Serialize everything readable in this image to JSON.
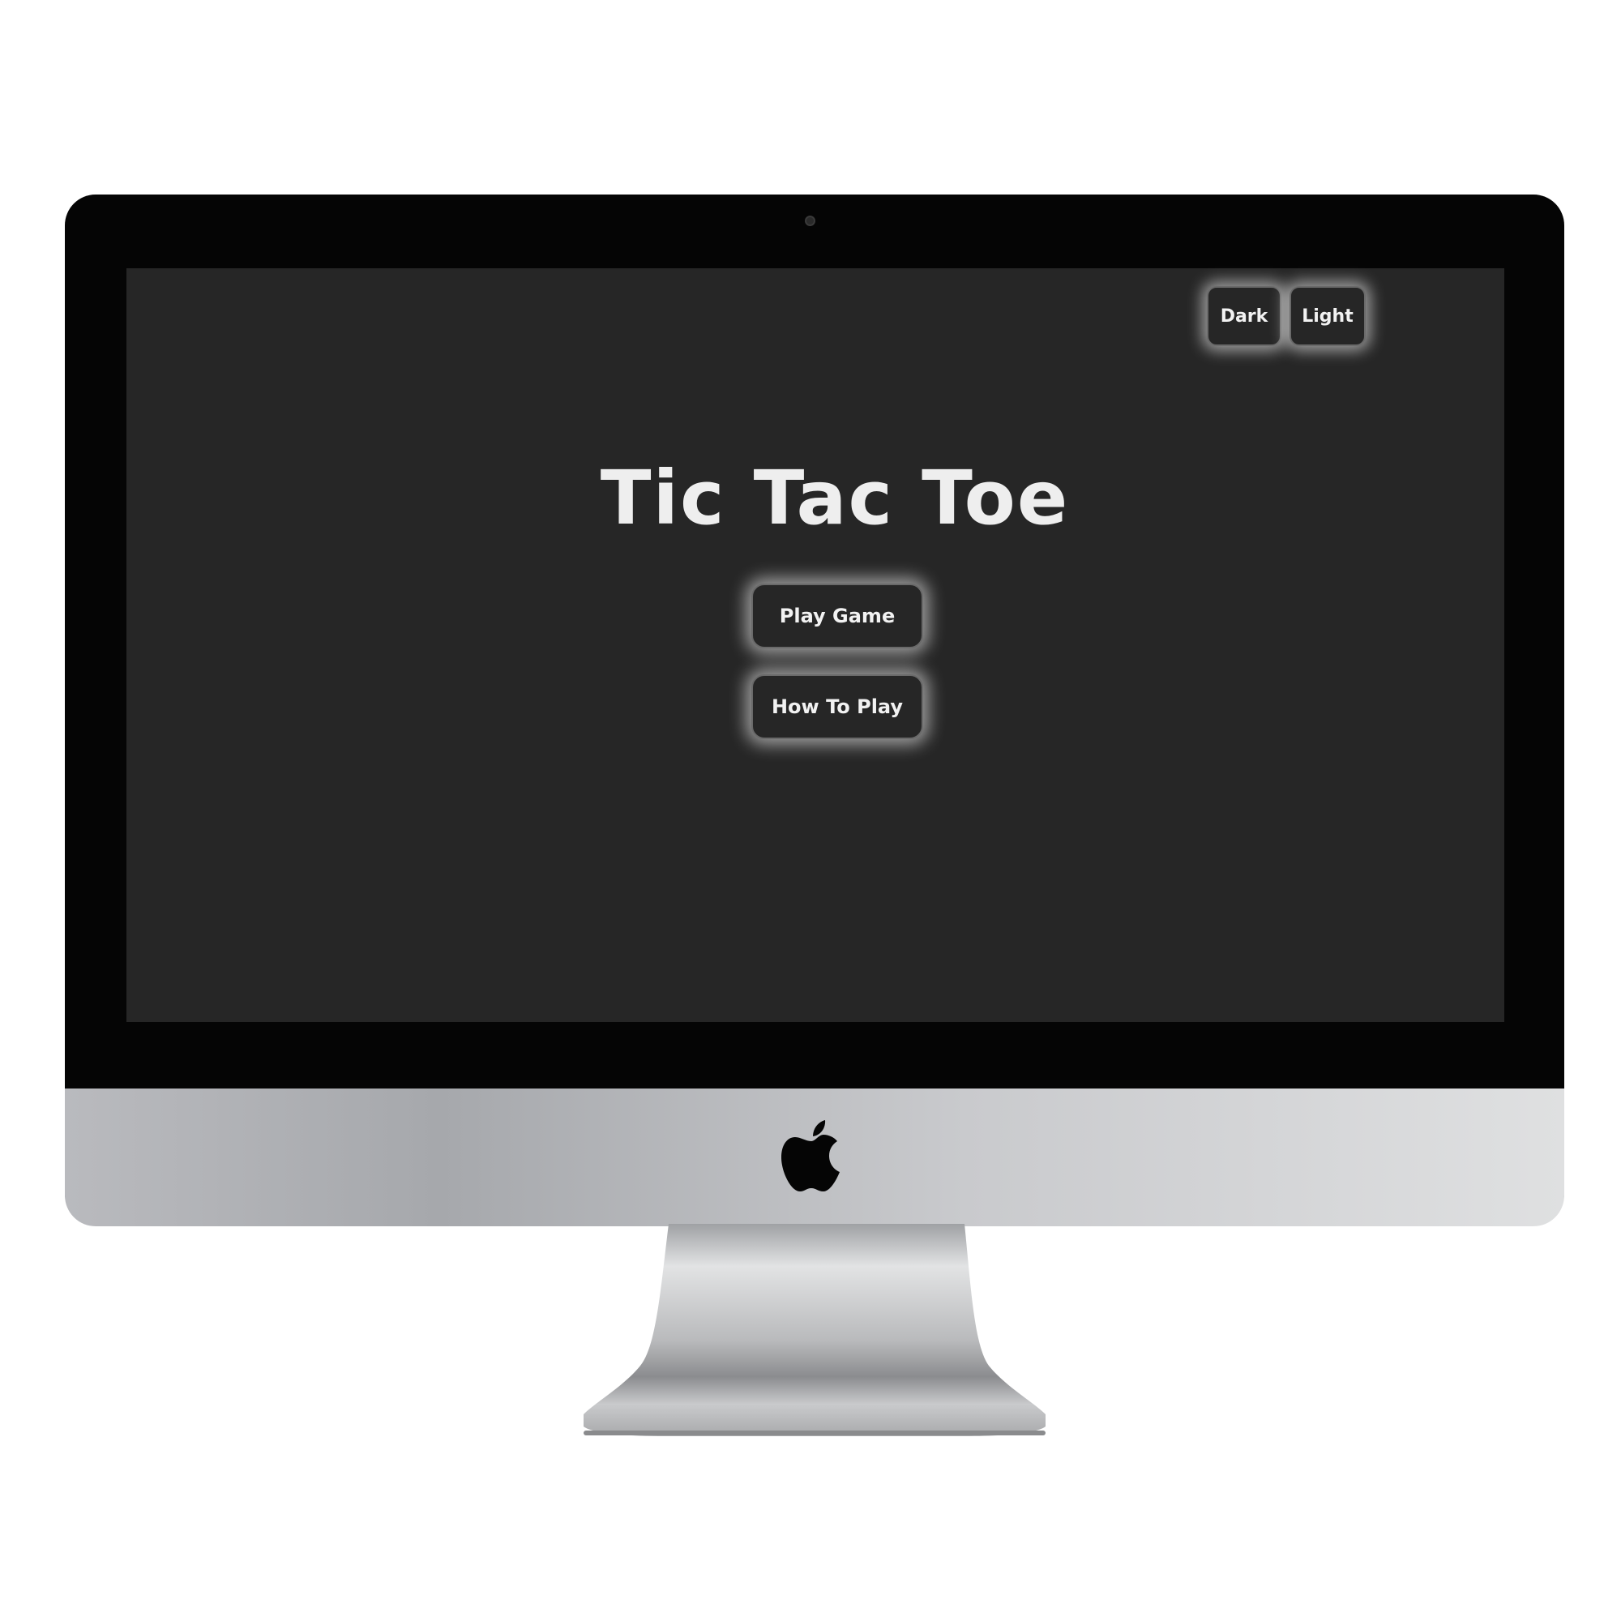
{
  "app": {
    "title": "Tic Tac Toe"
  },
  "theme_toggle": {
    "dark_label": "Dark",
    "light_label": "Light"
  },
  "menu": {
    "play_label": "Play Game",
    "how_to_label": "How To Play"
  },
  "icons": {
    "device_logo": "apple-logo-icon",
    "camera": "camera-icon"
  },
  "colors": {
    "screen_bg": "#262626",
    "text": "#eeeeee",
    "button_border": "#6a6a6a",
    "glow": "#ffffff"
  }
}
